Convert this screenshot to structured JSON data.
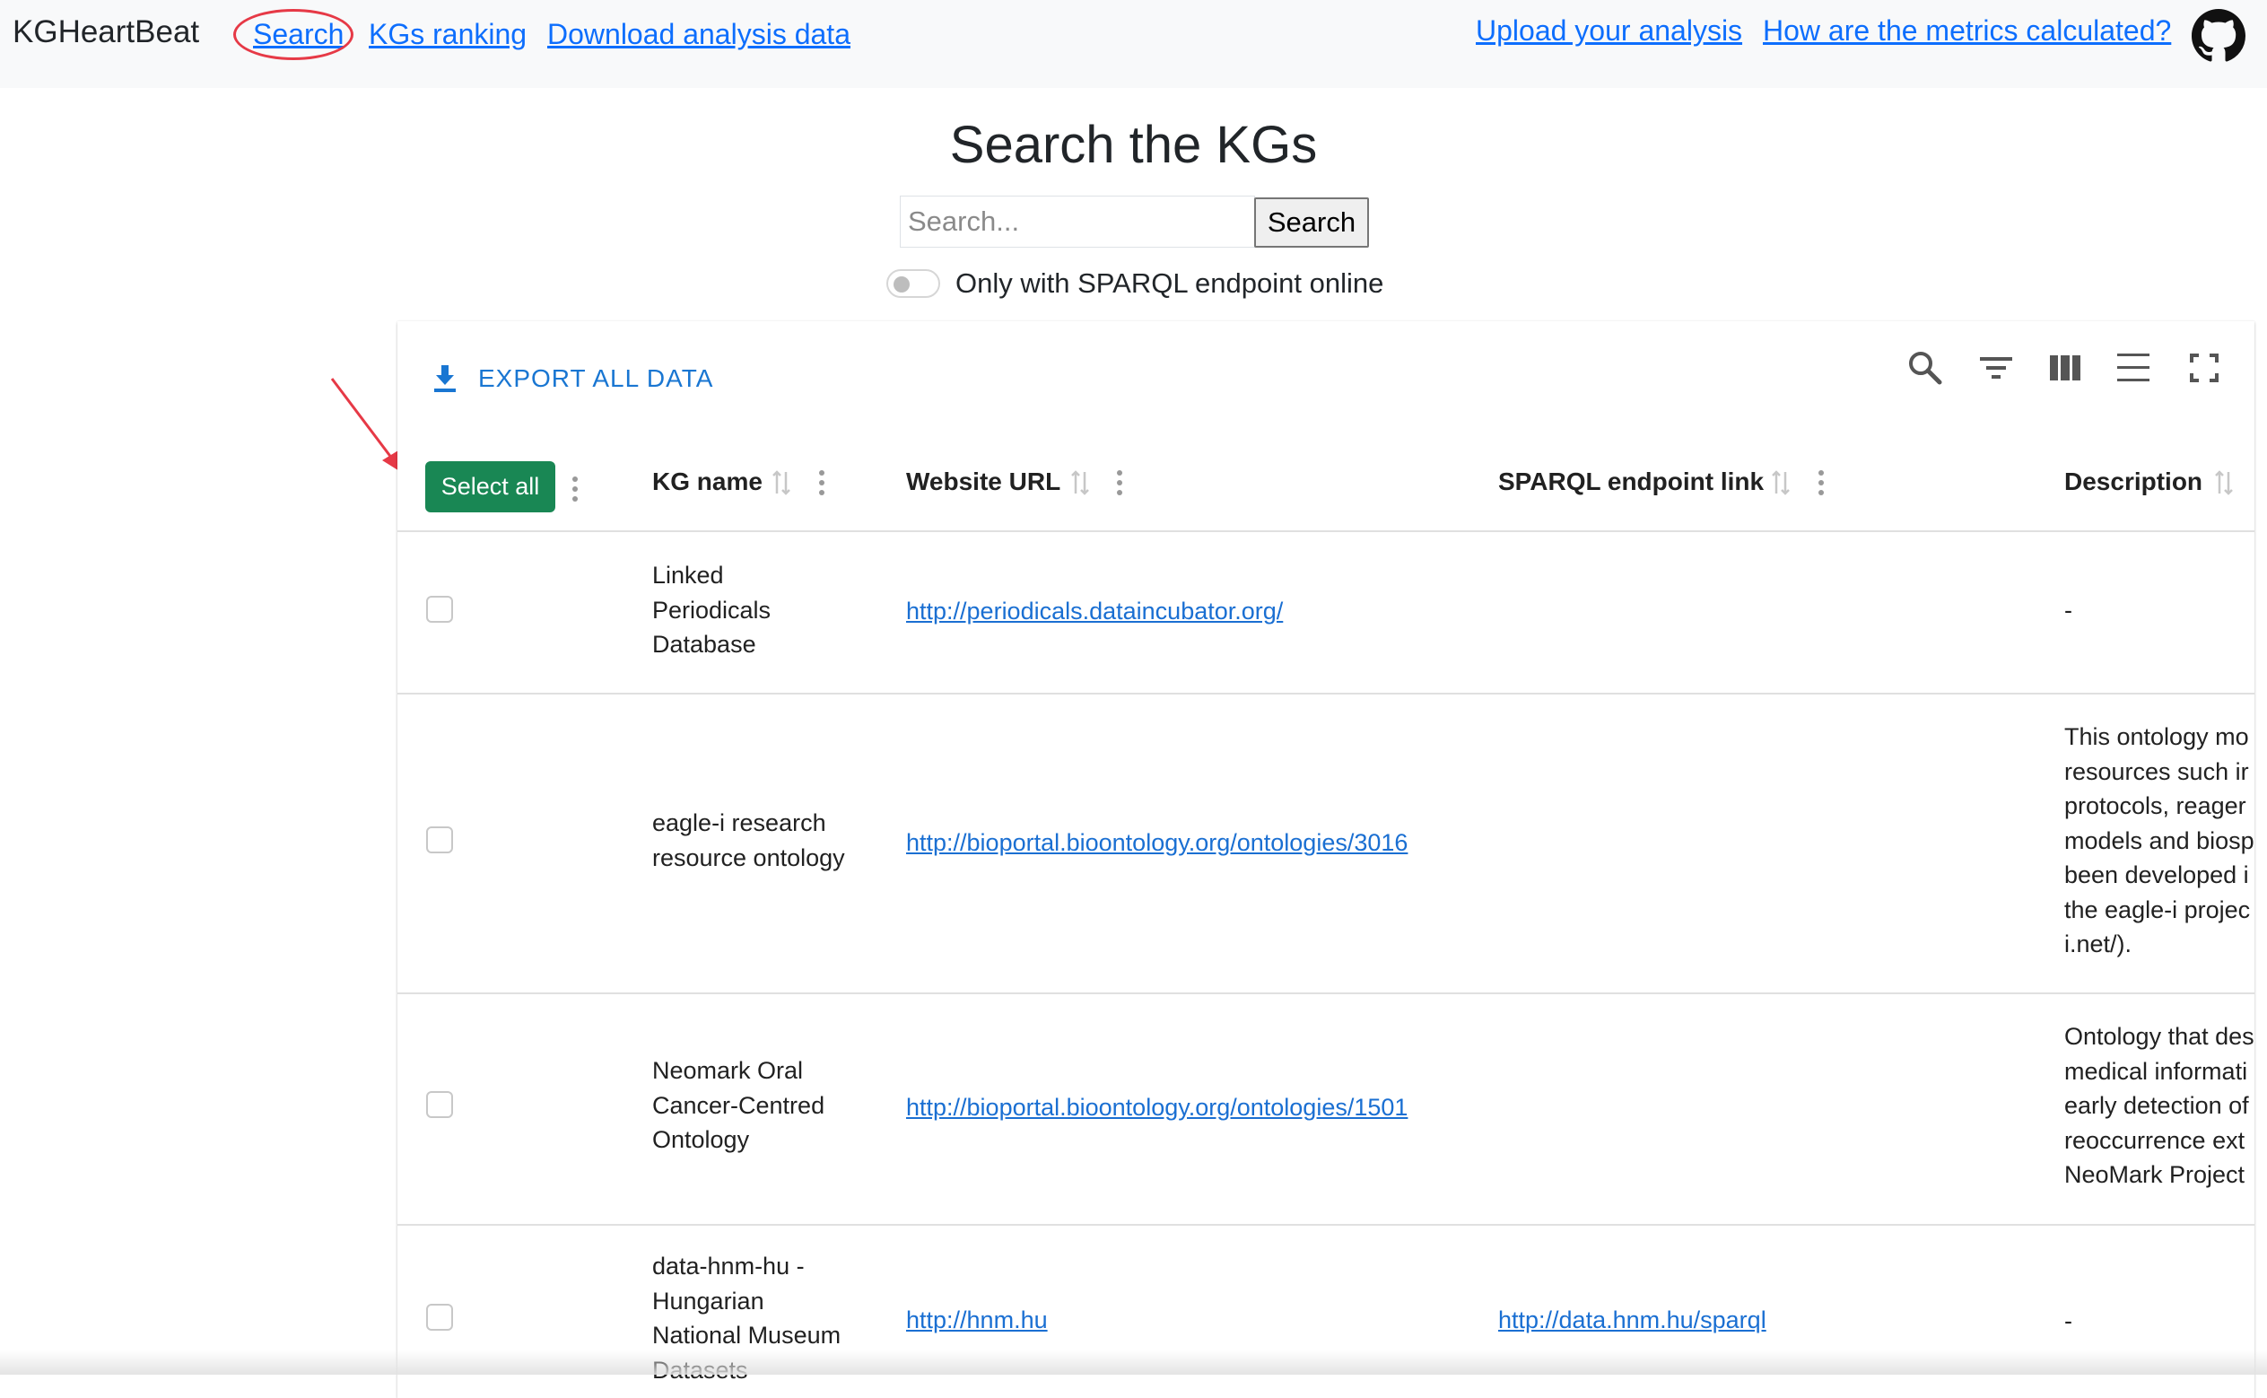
{
  "nav": {
    "brand": "KGHeartBeat",
    "links": [
      "Search",
      "KGs ranking",
      "Download analysis data"
    ],
    "right_links": [
      "Upload your analysis",
      "How are the metrics calculated?"
    ],
    "github_icon": "github-icon",
    "highlight_color": "#e63946"
  },
  "page": {
    "title": "Search the KGs",
    "search_placeholder": "Search...",
    "search_button": "Search",
    "toggle_label": "Only with SPARQL endpoint online"
  },
  "table": {
    "export_label": "EXPORT ALL DATA",
    "toolbar_icons": [
      "search-icon",
      "filter-icon",
      "columns-icon",
      "density-icon",
      "fullscreen-icon"
    ],
    "select_all": "Select all",
    "accent_color": "#198754",
    "link_color": "#1a6fd2",
    "columns": [
      "KG name",
      "Website URL",
      "SPARQL endpoint link",
      "Description"
    ],
    "rows": [
      {
        "kg_name": "Linked\nPeriodicals\nDatabase",
        "website": "http://periodicals.dataincubator.org/",
        "sparql": "",
        "description": "-"
      },
      {
        "kg_name": "eagle-i research\nresource ontology",
        "website": "http://bioportal.bioontology.org/ontologies/3016",
        "sparql": "",
        "description": "This ontology mo\nresources such ir\nprotocols, reager\nmodels and biosp\nbeen developed i\nthe eagle-i projec\ni.net/)."
      },
      {
        "kg_name": "Neomark Oral\nCancer-Centred\nOntology",
        "website": "http://bioportal.bioontology.org/ontologies/1501",
        "sparql": "",
        "description": "Ontology that des\nmedical informati\nearly detection of\nreoccurrence ext\nNeoMark Project"
      },
      {
        "kg_name": "data-hnm-hu -\nHungarian\nNational Museum\nDatasets",
        "website": "http://hnm.hu",
        "sparql": "http://data.hnm.hu/sparql",
        "description": "-"
      }
    ]
  }
}
